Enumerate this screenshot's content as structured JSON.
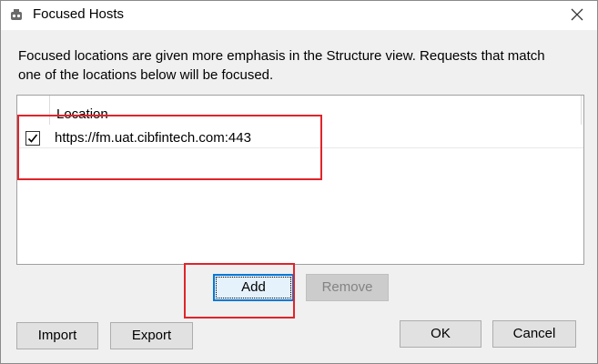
{
  "window": {
    "title": "Focused Hosts",
    "app_icon": "app-icon",
    "close_icon": "close-icon"
  },
  "description": "Focused locations are given more emphasis in the Structure view.  Requests that match one of the locations below will be focused.",
  "table": {
    "columns": [
      "",
      "Location"
    ],
    "rows": [
      {
        "checked": true,
        "location": "https://fm.uat.cibfintech.com:443"
      }
    ]
  },
  "buttons": {
    "add": "Add",
    "remove": "Remove",
    "import": "Import",
    "export": "Export",
    "ok": "OK",
    "cancel": "Cancel"
  },
  "colors": {
    "annotation": "#e0242b",
    "focus_border": "#0078d7",
    "button_bg": "#e1e1e1",
    "disabled_bg": "#cccccc"
  }
}
